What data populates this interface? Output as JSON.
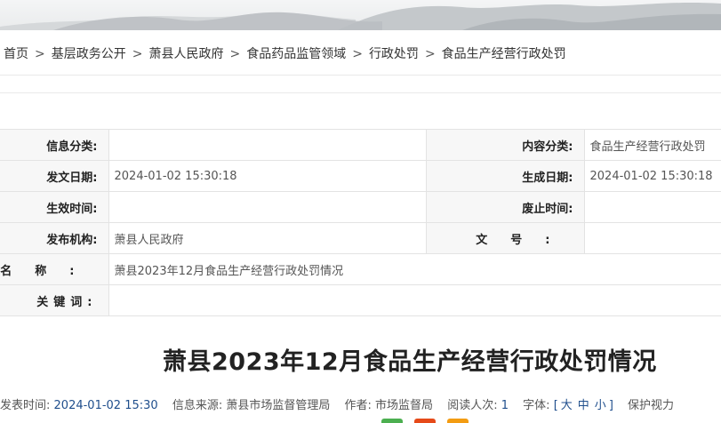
{
  "breadcrumb": {
    "items": [
      "首页",
      "基层政务公开",
      "萧县人民政府",
      "食品药品监管领域",
      "行政处罚",
      "食品生产经营行政处罚"
    ],
    "separator": ">"
  },
  "meta": {
    "category_label": "信息分类:",
    "category_value": "",
    "content_cat_label": "内容分类:",
    "content_cat_value": "食品生产经营行政处罚",
    "issue_date_label": "发文日期:",
    "issue_date_value": "2024-01-02 15:30:18",
    "gen_date_label": "生成日期:",
    "gen_date_value": "2024-01-02 15:30:18",
    "effective_label": "生效时间:",
    "effective_value": "",
    "repeal_label": "废止时间:",
    "repeal_value": "",
    "publisher_label": "发布机构:",
    "publisher_value": "萧县人民政府",
    "docno_label": "文号:",
    "docno_value": "",
    "name_label": "名称:",
    "name_value": "萧县2023年12月食品生产经营行政处罚情况",
    "keywords_label": "关键词:",
    "keywords_value": ""
  },
  "article": {
    "title": "萧县2023年12月食品生产经营行政处罚情况"
  },
  "info": {
    "publish_time_label": "发表时间:",
    "publish_time_value": "2024-01-02 15:30",
    "source_label": "信息来源:",
    "source_value": "萧县市场监督管理局",
    "author_label": "作者:",
    "author_value": "市场监督局",
    "reads_label": "阅读人次:",
    "reads_value": "1",
    "font_label": "字体:",
    "font_large": "大",
    "font_medium": "中",
    "font_small": "小",
    "eye_label": "保护视力"
  },
  "colors": {
    "link_blue": "#1f4e8c",
    "header_cell_bg": "#f7f7f7",
    "border": "#e3e3e3",
    "share_green": "#4caf50",
    "share_red": "#e64a19",
    "share_orange": "#f39c12"
  }
}
